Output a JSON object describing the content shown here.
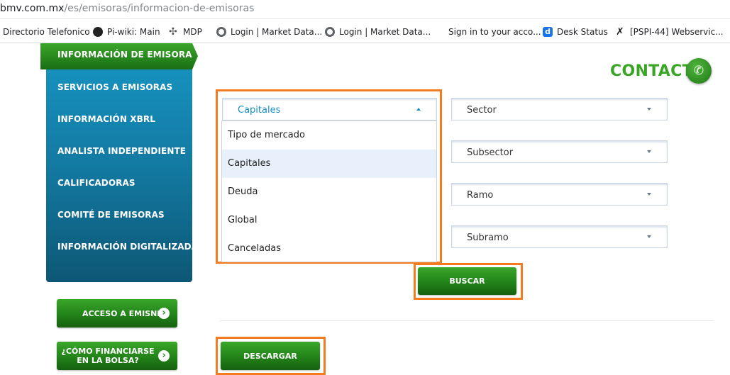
{
  "browser": {
    "url_host": "bmv.com.mx",
    "url_path": "/es/emisoras/informacion-de-emisoras",
    "bookmarks": [
      {
        "label": "Directorio Telefonico",
        "icon": "none"
      },
      {
        "label": "Pi-wiki: Main",
        "icon": "wiki-icon"
      },
      {
        "label": "MDP",
        "icon": "mdp-icon"
      },
      {
        "label": "Login | Market Data...",
        "icon": "globe-icon"
      },
      {
        "label": "Login | Market Data...",
        "icon": "globe-icon"
      },
      {
        "label": "Sign in to your acco...",
        "icon": "microsoft-icon"
      },
      {
        "label": "Desk Status",
        "icon": "d-icon"
      },
      {
        "label": "[PSPI-44] Webservic...",
        "icon": "jira-icon"
      }
    ]
  },
  "sidebar": {
    "active_label": "INFORMACIÓN DE EMISORA",
    "items": [
      {
        "label": "SERVICIOS A EMISORAS"
      },
      {
        "label": "INFORMACIÓN XBRL"
      },
      {
        "label": "ANALISTA INDEPENDIENTE"
      },
      {
        "label": "CALIFICADORAS"
      },
      {
        "label": "COMITÉ DE EMISORAS"
      },
      {
        "label": "INFORMACIÓN DIGITALIZADA"
      }
    ],
    "emisnet_button": "ACCESO A EMISNET",
    "financiarse_line1": "¿CÓMO FINANCIARSE",
    "financiarse_line2": "EN LA BOLSA?"
  },
  "contact": {
    "label": "CONTACTO"
  },
  "filters": {
    "market_select": {
      "value": "Capitales",
      "options": [
        "Tipo de mercado",
        "Capitales",
        "Deuda",
        "Global",
        "Canceladas"
      ],
      "selected_index": 1
    },
    "sector": "Sector",
    "subsector": "Subsector",
    "ramo": "Ramo",
    "subramo": "Subramo"
  },
  "actions": {
    "search_label": "BUSCAR",
    "download_label": "DESCARGAR"
  },
  "colors": {
    "highlight": "#f47b20",
    "brand_green": "#3aa626",
    "sidebar_blue": "#1690bd"
  }
}
